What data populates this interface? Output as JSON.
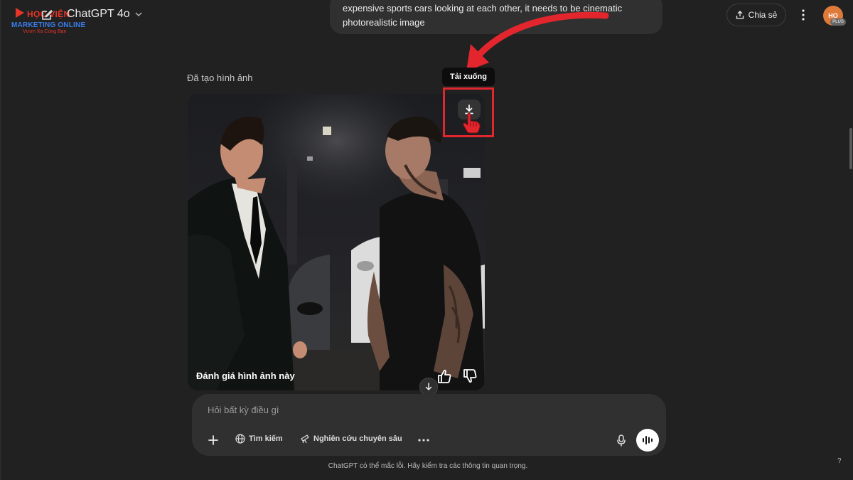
{
  "brand": {
    "name": "HỌC VIỆN",
    "tagline": "MARKETING ONLINE",
    "slogan": "Vươn Xa Cùng Bạn"
  },
  "header": {
    "model": "ChatGPT 4o",
    "share_label": "Chia sẻ",
    "avatar_initials": "HO",
    "avatar_badge": "PLUS"
  },
  "chat": {
    "user_message": "expensive sports cars looking at each other, it needs to be cinematic photorealistic image",
    "generated_label": "Đã tạo hình ảnh",
    "download_tooltip": "Tải xuống",
    "rate_prompt": "Đánh giá hình ảnh này"
  },
  "composer": {
    "placeholder": "Hỏi bất kỳ điều gì",
    "tools": [
      "Tìm kiếm",
      "Nghiên cứu chuyên sâu"
    ]
  },
  "footer": {
    "disclaimer": "ChatGPT có thể mắc lỗi. Hãy kiểm tra các thông tin quan trọng.",
    "help": "?"
  },
  "colors": {
    "background": "#212121",
    "bubble": "#303030",
    "annotation_red": "#e3262d",
    "brand_red": "#e8352a",
    "brand_blue": "#3b7de9"
  }
}
